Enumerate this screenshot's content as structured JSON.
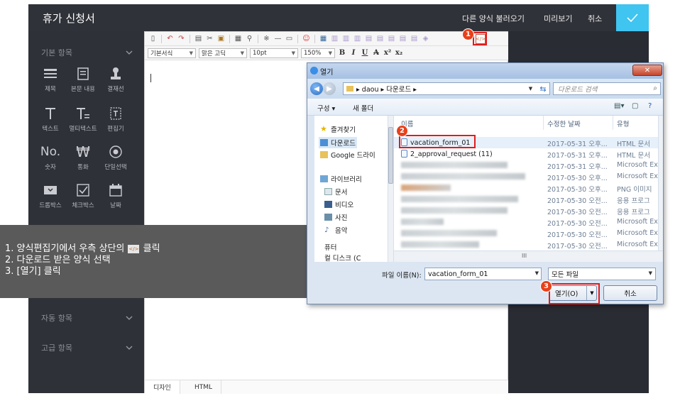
{
  "header": {
    "title": "휴가 신청서",
    "load_other": "다른 양식 불러오기",
    "preview": "미리보기",
    "cancel": "취소"
  },
  "sidebar": {
    "basic_section": "기본 항목",
    "tools": [
      {
        "label": "제목",
        "icon": "title-icon"
      },
      {
        "label": "본문 내용",
        "icon": "body-text-icon"
      },
      {
        "label": "결재선",
        "icon": "approval-line-icon"
      },
      {
        "label": "텍스트",
        "icon": "text-icon"
      },
      {
        "label": "멀티텍스트",
        "icon": "multitext-icon"
      },
      {
        "label": "편집기",
        "icon": "editor-icon"
      },
      {
        "label": "숫자",
        "icon": "number-icon"
      },
      {
        "label": "통화",
        "icon": "currency-icon"
      },
      {
        "label": "단일선택",
        "icon": "radio-icon"
      },
      {
        "label": "드롭박스",
        "icon": "dropdown-icon"
      },
      {
        "label": "체크박스",
        "icon": "checkbox-icon"
      },
      {
        "label": "날짜",
        "icon": "calendar-icon"
      }
    ],
    "auto_section": "자동 항목",
    "advanced_section": "고급 항목"
  },
  "editor": {
    "style_select": "기본서식",
    "font_select": "맑은 고딕",
    "size_select": "10pt",
    "zoom_select": "150%",
    "tabs": [
      "디자인",
      "HTML"
    ],
    "html_button_glyph": "</>"
  },
  "instructions": {
    "line1_before": "1.  양식편집기에서 우측 상단의",
    "line1_after": "클릭",
    "line2": "2.  다운로드 받은 양식 선택",
    "line3": "3.  [열기] 클릭"
  },
  "badges": [
    "1",
    "2",
    "3"
  ],
  "dialog": {
    "title": "열기",
    "breadcrumb": "▸ daou ▸ 다운로드 ▸",
    "search_placeholder": "다운로드 검색",
    "organize": "구성 ▾",
    "new_folder": "새 폴더",
    "nav_items": [
      {
        "label": "즐겨찾기",
        "icon": "star-icon"
      },
      {
        "label": "다운로드",
        "icon": "download-folder-icon"
      },
      {
        "label": "Google 드라이",
        "icon": "drive-folder-icon"
      },
      {
        "label": "라이브러리",
        "icon": "library-icon"
      },
      {
        "label": "문서",
        "icon": "documents-icon"
      },
      {
        "label": "비디오",
        "icon": "video-icon"
      },
      {
        "label": "사진",
        "icon": "pictures-icon"
      },
      {
        "label": "음악",
        "icon": "music-icon"
      },
      {
        "label": "퓨터",
        "icon": "computer-icon"
      },
      {
        "label": "컬 디스크 (C",
        "icon": "disk-icon"
      }
    ],
    "columns": {
      "name": "이름",
      "date": "수정한 날짜",
      "type": "유형"
    },
    "files": [
      {
        "name": "vacation_form_01",
        "date": "2017-05-31 오후...",
        "type": "HTML 문서"
      },
      {
        "name": "2_approval_request (11)",
        "date": "2017-05-31 오후...",
        "type": "HTML 문서"
      },
      {
        "name": "",
        "date": "2017-05-31 오후...",
        "type": "Microsoft Ex"
      },
      {
        "name": "",
        "date": "2017-05-30 오후...",
        "type": "Microsoft Ex"
      },
      {
        "name": "",
        "date": "2017-05-30 오후...",
        "type": "PNG 이미지"
      },
      {
        "name": "",
        "date": "2017-05-30 오전...",
        "type": "응용 프로그"
      },
      {
        "name": "",
        "date": "2017-05-30 오전...",
        "type": "응용 프로그"
      },
      {
        "name": "",
        "date": "2017-05-30 오전...",
        "type": "Microsoft Ex"
      },
      {
        "name": "",
        "date": "2017-05-30 오전...",
        "type": "Microsoft Ex"
      },
      {
        "name": "",
        "date": "2017-05-30 오전...",
        "type": "Microsoft Ex"
      }
    ],
    "filename_label": "파일 이름(N):",
    "filename_value": "vacation_form_01",
    "filetype_value": "모든 파일",
    "open_button": "열기(O)",
    "cancel_button": "취소",
    "hscroll_glyph": "III"
  },
  "colors": {
    "accent": "#40c4f0",
    "highlight": "#e21b1b",
    "badge": "#e8401a",
    "app_bg": "#2e3038"
  }
}
